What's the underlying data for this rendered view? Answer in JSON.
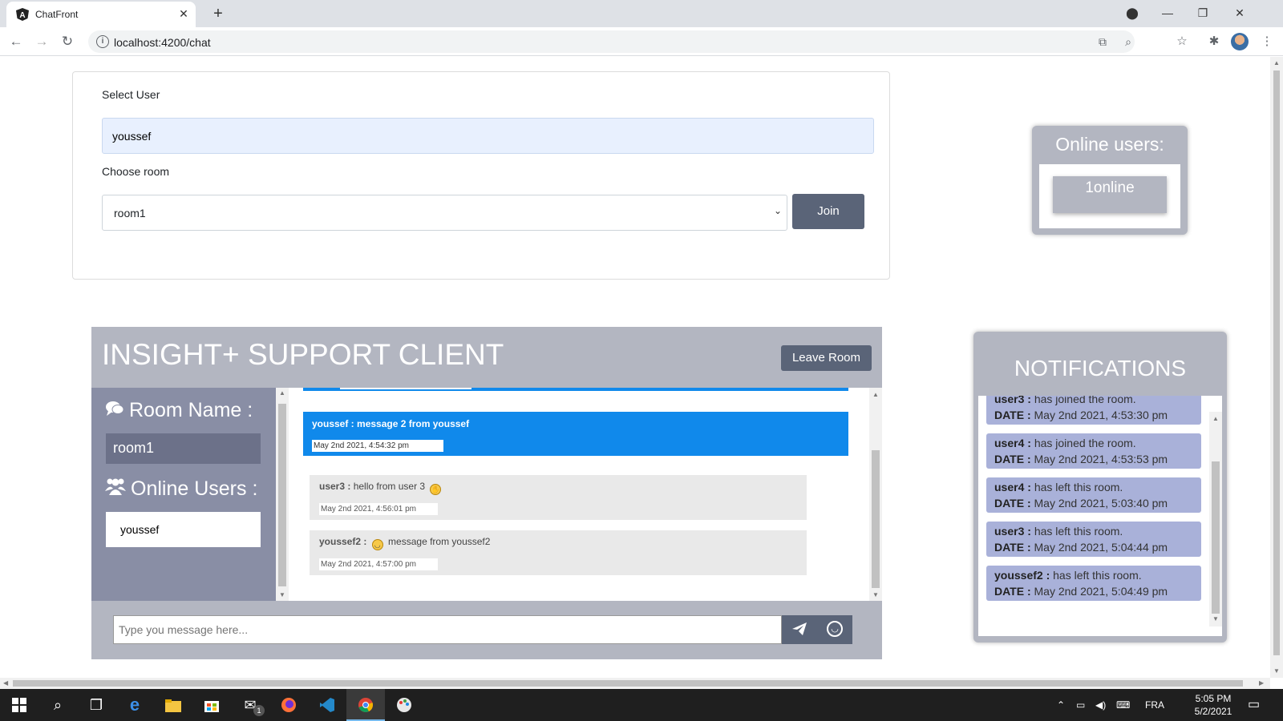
{
  "browser": {
    "tab_title": "ChatFront",
    "url": "localhost:4200/chat"
  },
  "form": {
    "select_user_label": "Select User",
    "user_value": "youssef",
    "choose_room_label": "Choose room",
    "room_value": "room1",
    "join_label": "Join"
  },
  "online_box": {
    "title": "Online users:",
    "count_text": "1online"
  },
  "chat": {
    "title": "INSIGHT+ SUPPORT CLIENT",
    "leave_label": "Leave Room",
    "room_name_heading": "Room Name :",
    "room_name": "room1",
    "online_users_heading": "Online Users :",
    "online_users": [
      "youssef"
    ],
    "messages": [
      {
        "user": "youssef :",
        "text": "message 2 from youssef",
        "date": "May 2nd 2021, 4:54:32 pm",
        "own": true
      },
      {
        "user": "user3 :",
        "text": "hello from user 3",
        "date": "May 2nd 2021, 4:56:01 pm",
        "own": false
      },
      {
        "user": "youssef2 :",
        "text": "message from youssef2",
        "date": "May 2nd 2021, 4:57:00 pm",
        "own": false
      }
    ],
    "input_placeholder": "Type you message here..."
  },
  "notifications": {
    "title": "NOTIFICATIONS",
    "items": [
      {
        "user": "user3 :",
        "action": "has joined the room.",
        "date_label": "DATE :",
        "date": "May 2nd 2021, 4:53:30 pm"
      },
      {
        "user": "user4 :",
        "action": "has joined the room.",
        "date_label": "DATE :",
        "date": "May 2nd 2021, 4:53:53 pm"
      },
      {
        "user": "user4 :",
        "action": "has left this room.",
        "date_label": "DATE :",
        "date": "May 2nd 2021, 5:03:40 pm"
      },
      {
        "user": "user3 :",
        "action": "has left this room.",
        "date_label": "DATE :",
        "date": "May 2nd 2021, 5:04:44 pm"
      },
      {
        "user": "youssef2 :",
        "action": "has left this room.",
        "date_label": "DATE :",
        "date": "May 2nd 2021, 5:04:49 pm"
      }
    ]
  },
  "taskbar": {
    "language": "FRA",
    "time": "5:05 PM",
    "date": "5/2/2021",
    "mail_badge": "1"
  },
  "colors": {
    "primary_button": "#5a6478",
    "panel_gray": "#b3b6c1",
    "sidebar": "#898ea5",
    "own_message": "#1089eb",
    "notification_item": "#a9b1d9"
  }
}
